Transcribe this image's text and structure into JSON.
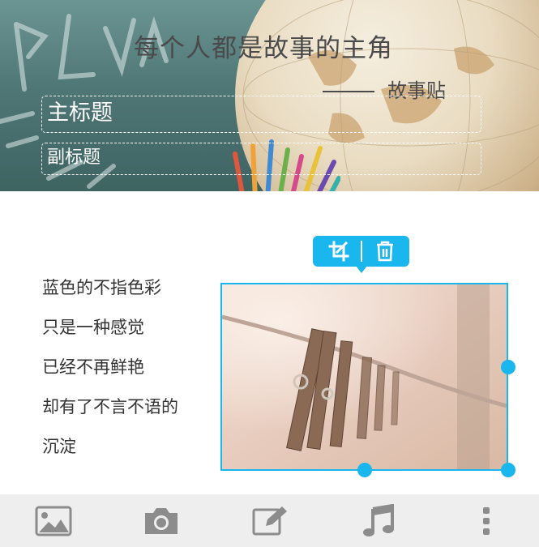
{
  "header": {
    "slogan": "每个人都是故事的主角",
    "brand": "故事贴",
    "title_placeholder": "主标题",
    "subtitle_placeholder": "副标题"
  },
  "poem": {
    "lines": [
      "蓝色的不指色彩",
      "只是一种感觉",
      "已经不再鲜艳",
      "却有了不言不语的",
      "沉淀"
    ]
  },
  "image_toolbar": {
    "actions": [
      {
        "icon": "crop-icon"
      },
      {
        "icon": "trash-icon"
      }
    ]
  },
  "bottom_bar": {
    "items": [
      {
        "icon": "image-icon"
      },
      {
        "icon": "camera-icon"
      },
      {
        "icon": "edit-icon"
      },
      {
        "icon": "music-icon"
      },
      {
        "icon": "more-vertical-icon"
      }
    ]
  },
  "colors": {
    "accent": "#1ab6ee",
    "bottom_bar_bg": "#eeeeee",
    "icon_gray": "#8c8c8c",
    "text": "#333333"
  }
}
